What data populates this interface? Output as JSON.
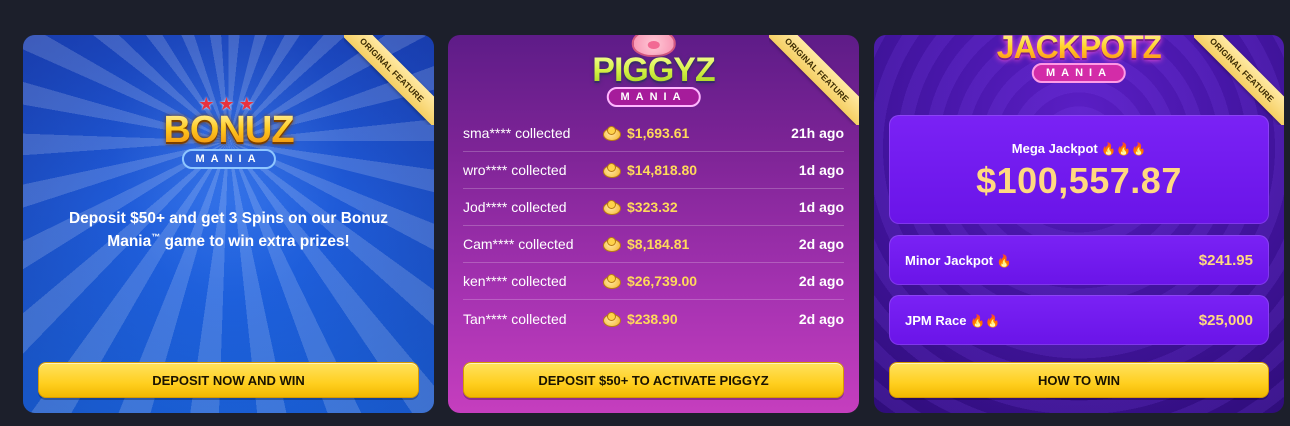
{
  "ribbon_label": "ORIGINAL FEATURE",
  "bonuz": {
    "logo_word": "BONUZ",
    "logo_sub": "MANIA",
    "promo_pre": "Deposit $50+ and get ",
    "promo_bold1": "3 Spins",
    "promo_mid": " on our ",
    "promo_bold2": "Bonuz Mania",
    "promo_tm": "™",
    "promo_post": " game to win extra prizes!",
    "cta_label": "DEPOSIT NOW AND WIN"
  },
  "piggyz": {
    "logo_word": "PIGGYZ",
    "logo_sub": "MANIA",
    "feed": [
      {
        "user": "sma**** collected",
        "amount": "$1,693.61",
        "time": "21h ago"
      },
      {
        "user": "wro**** collected",
        "amount": "$14,818.80",
        "time": "1d ago"
      },
      {
        "user": "Jod**** collected",
        "amount": "$323.32",
        "time": "1d ago"
      },
      {
        "user": "Cam**** collected",
        "amount": "$8,184.81",
        "time": "2d ago"
      },
      {
        "user": "ken**** collected",
        "amount": "$26,739.00",
        "time": "2d ago"
      },
      {
        "user": "Tan**** collected",
        "amount": "$238.90",
        "time": "2d ago"
      }
    ],
    "cta_label": "DEPOSIT $50+ TO ACTIVATE PIGGYZ"
  },
  "jackpotz": {
    "logo_word": "JACKPOTZ",
    "logo_sub": "MANIA",
    "mega_label": "Mega Jackpot",
    "mega_fire": "🔥🔥🔥",
    "mega_value": "$100,557.87",
    "minor_label": "Minor Jackpot",
    "minor_fire": "🔥",
    "minor_value": "$241.95",
    "jpm_label": "JPM Race",
    "jpm_fire": "🔥🔥",
    "jpm_value": "$25,000",
    "cta_label": "HOW TO WIN"
  },
  "colors": {
    "bonuz_bg": "#1f5bd8",
    "piggyz_bg": "#a733b2",
    "jackpotz_bg": "#4716a8",
    "cta_yellow": "#ffcf1f",
    "amount_gold": "#ffd95a"
  }
}
